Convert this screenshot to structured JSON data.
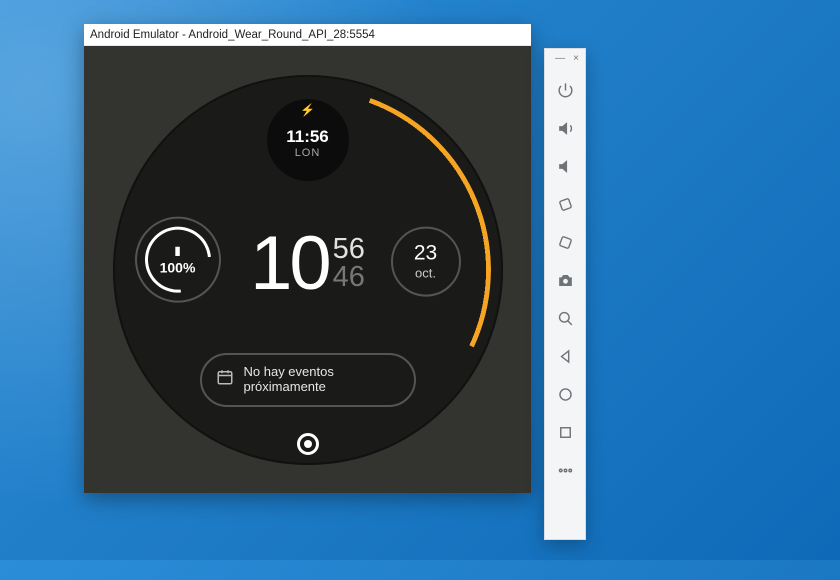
{
  "window": {
    "title": "Android Emulator - Android_Wear_Round_API_28:5554"
  },
  "watch": {
    "world_time": {
      "time": "11:56",
      "city": "LON"
    },
    "main": {
      "hour": "10",
      "minute": "56",
      "second": "46"
    },
    "battery": {
      "percent": "100%"
    },
    "date": {
      "day": "23",
      "month": "oct."
    },
    "calendar": {
      "line1": "No hay eventos",
      "line2": "próximamente"
    }
  },
  "toolbar": {
    "minimize": "—",
    "close": "×",
    "items": {
      "power": "power",
      "vol_up": "volume-up",
      "vol_down": "volume-down",
      "rotate_left": "rotate-left",
      "rotate_right": "rotate-right",
      "screenshot": "camera",
      "zoom": "zoom",
      "back": "back",
      "home": "home",
      "overview": "overview",
      "more": "more"
    }
  }
}
